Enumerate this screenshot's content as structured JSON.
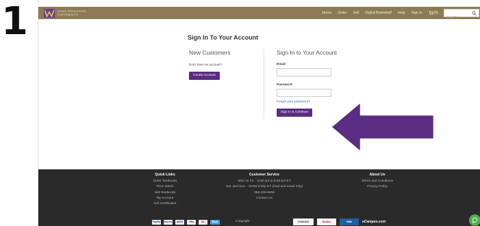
{
  "step": {
    "number": "1"
  },
  "header": {
    "logo_text": "IOWA WESLEYAN UNIVERSITY",
    "logo_icon": "w-crest-icon",
    "nav": [
      "Home",
      "Order",
      "Sell",
      "Digital Bookshelf",
      "Help",
      "Sign In"
    ],
    "cart_count": "(0)",
    "search_placeholder": "Search",
    "colors": {
      "bar": "#8c7a52",
      "text": "#f6f0e2"
    }
  },
  "main": {
    "page_title": "Sign In To Your Account",
    "new_customers": {
      "heading": "New Customers",
      "prompt": "Don't have an account?",
      "create_button": "Create Account"
    },
    "sign_in": {
      "heading": "Sign In to Your Account",
      "email_label": "Email",
      "password_label": "Password",
      "forgot_link": "Forgot your password?",
      "submit_button": "Sign In & Continue"
    },
    "accent_color": "#5a2d82"
  },
  "annotation": {
    "arrow_icon": "left-arrow-icon",
    "color": "#5a2d82"
  },
  "footer": {
    "quick_links": {
      "heading": "Quick Links",
      "items": [
        "Order Textbooks",
        "Price Match",
        "Sell Textbooks",
        "My Account",
        "Gift Certificates"
      ]
    },
    "customer_service": {
      "heading": "Customer Service",
      "lines": [
        "Mon. to Fri. - 8:30 am to 6:00 pm ET",
        "Sat. and Sun. - 9:00a-5:00p ET (chat and email only)",
        "859-209-6958",
        "Contact Us"
      ]
    },
    "about": {
      "heading": "About Us",
      "items": [
        "Terms and Conditions",
        "Privacy Policy"
      ]
    },
    "payments": [
      "PayPal",
      "Discover",
      "AMEX",
      "VISA",
      "MC",
      "Bank"
    ],
    "copyright": "Copyright",
    "badges": [
      "COMODO",
      "McAfee",
      "BBB",
      "eCampus.com"
    ]
  },
  "chat": {
    "icon": "chat-bubble-icon",
    "color": "#4cae4c"
  }
}
